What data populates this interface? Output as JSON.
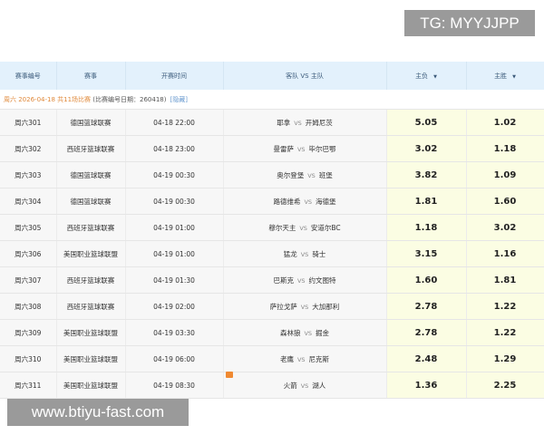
{
  "headers": {
    "num": "赛事编号",
    "league": "赛事",
    "time": "开赛时间",
    "teams": "客队 VS 主队",
    "lose": "主负",
    "win": "主胜"
  },
  "info": {
    "date": "周六 2026-04-18 共11场比赛",
    "code": "(比赛编号日期：260418)",
    "hide": "[隐藏]"
  },
  "vs": "VS",
  "rows": [
    {
      "num": "周六301",
      "league": "德国篮球联赛",
      "time": "04-18 22:00",
      "away": "耶拿",
      "home": "开姆尼茨",
      "lose": "5.05",
      "win": "1.02"
    },
    {
      "num": "周六302",
      "league": "西班牙篮球联赛",
      "time": "04-18 23:00",
      "away": "曼雷萨",
      "home": "毕尔巴鄂",
      "lose": "3.02",
      "win": "1.18"
    },
    {
      "num": "周六303",
      "league": "德国篮球联赛",
      "time": "04-19 00:30",
      "away": "奥尔登堡",
      "home": "班堡",
      "lose": "3.82",
      "win": "1.09"
    },
    {
      "num": "周六304",
      "league": "德国篮球联赛",
      "time": "04-19 00:30",
      "away": "路德维希",
      "home": "海德堡",
      "lose": "1.81",
      "win": "1.60"
    },
    {
      "num": "周六305",
      "league": "西班牙篮球联赛",
      "time": "04-19 01:00",
      "away": "穆尔天主",
      "home": "安道尔BC",
      "lose": "1.18",
      "win": "3.02"
    },
    {
      "num": "周六306",
      "league": "美国职业篮球联盟",
      "time": "04-19 01:00",
      "away": "猛龙",
      "home": "骑士",
      "lose": "3.15",
      "win": "1.16"
    },
    {
      "num": "周六307",
      "league": "西班牙篮球联赛",
      "time": "04-19 01:30",
      "away": "巴斯克",
      "home": "约文图特",
      "lose": "1.60",
      "win": "1.81"
    },
    {
      "num": "周六308",
      "league": "西班牙篮球联赛",
      "time": "04-19 02:00",
      "away": "萨拉戈萨",
      "home": "大加那利",
      "lose": "2.78",
      "win": "1.22"
    },
    {
      "num": "周六309",
      "league": "美国职业篮球联盟",
      "time": "04-19 03:30",
      "away": "森林狼",
      "home": "掘金",
      "lose": "2.78",
      "win": "1.22"
    },
    {
      "num": "周六310",
      "league": "美国职业篮球联盟",
      "time": "04-19 06:00",
      "away": "老鹰",
      "home": "尼克斯",
      "lose": "2.48",
      "win": "1.29"
    },
    {
      "num": "周六311",
      "league": "美国职业篮球联盟",
      "time": "04-19 08:30",
      "away": "火箭",
      "home": "湖人",
      "lose": "1.36",
      "win": "2.25"
    }
  ],
  "watermarks": {
    "tg": "TG: MYYJJPP",
    "site": "www.btiyu-fast.com"
  }
}
